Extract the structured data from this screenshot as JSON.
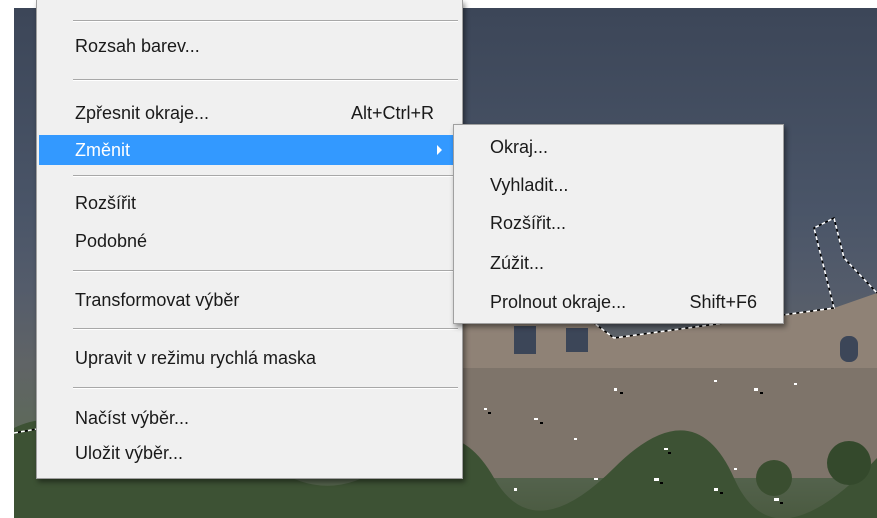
{
  "main_menu": {
    "items": [
      {
        "label": "Rozsah barev..."
      },
      {
        "label": "Zpřesnit okraje...",
        "shortcut": "Alt+Ctrl+R"
      },
      {
        "label": "Změnit"
      },
      {
        "label": "Rozšířit"
      },
      {
        "label": "Podobné"
      },
      {
        "label": "Transformovat výběr"
      },
      {
        "label": "Upravit v režimu rychlá maska"
      },
      {
        "label": "Načíst výběr..."
      },
      {
        "label": "Uložit výběr..."
      }
    ]
  },
  "sub_menu": {
    "items": [
      {
        "label": "Okraj..."
      },
      {
        "label": "Vyhladit..."
      },
      {
        "label": "Rozšířit..."
      },
      {
        "label": "Zúžit..."
      },
      {
        "label": "Prolnout okraje...",
        "shortcut": "Shift+F6"
      }
    ]
  },
  "colors": {
    "highlight": "#3399ff",
    "menu_bg": "#f0f0f0"
  },
  "icons": [
    "submenu-arrow-icon"
  ]
}
